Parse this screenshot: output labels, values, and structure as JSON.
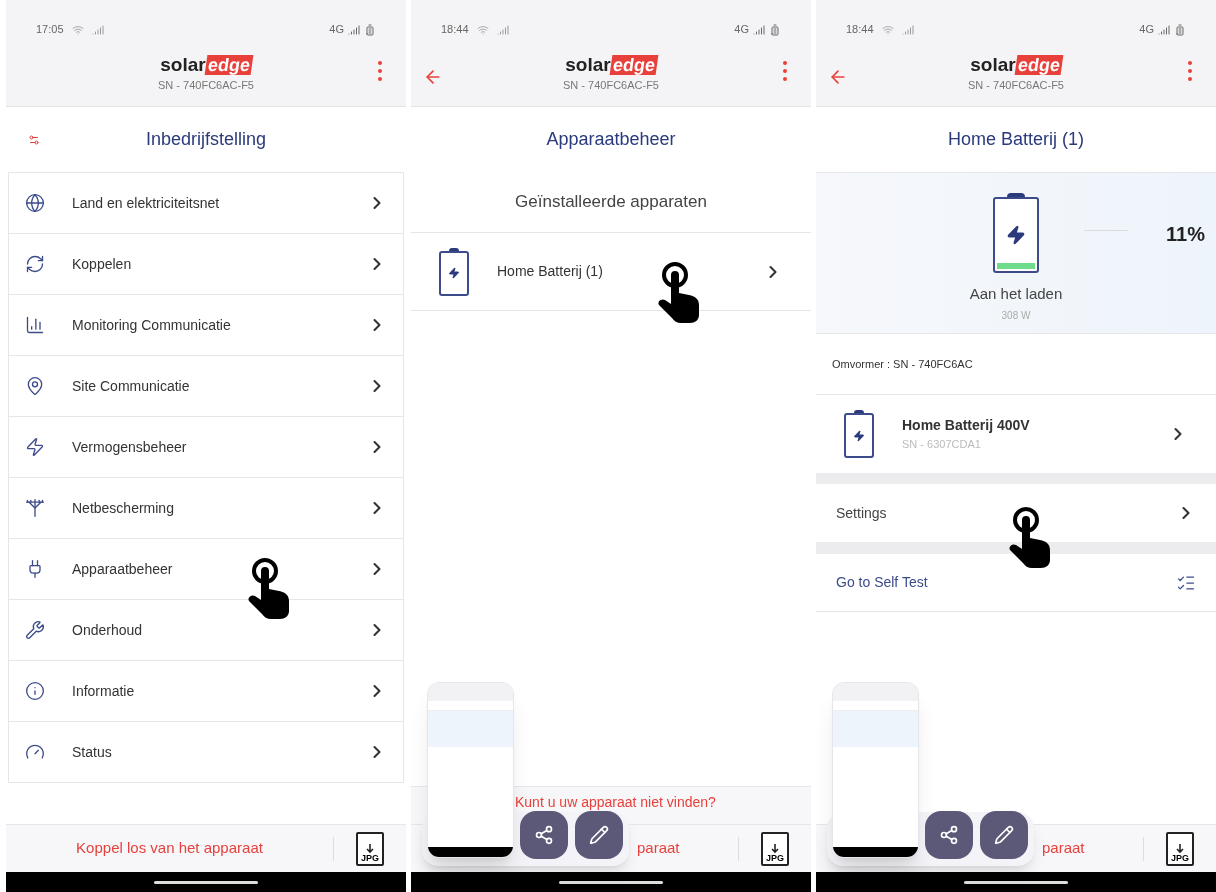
{
  "screens": [
    {
      "kind": "menu",
      "status_bar": {
        "time": "17:05",
        "network": "4G"
      },
      "header": {
        "back": false,
        "logo": [
          "solar",
          "edge"
        ],
        "serial": "SN - 740FC6AC-F5"
      },
      "title": "Inbedrijfstelling",
      "items": [
        {
          "label": "Land en elektriciteitsnet",
          "tapped": false
        },
        {
          "label": "Koppelen",
          "tapped": false
        },
        {
          "label": "Monitoring Communicatie",
          "tapped": false
        },
        {
          "label": "Site Communicatie",
          "tapped": false
        },
        {
          "label": "Vermogensbeheer",
          "tapped": false
        },
        {
          "label": "Netbescherming",
          "tapped": false
        },
        {
          "label": "Apparaatbeheer",
          "tapped": true
        },
        {
          "label": "Onderhoud",
          "tapped": false
        },
        {
          "label": "Informatie",
          "tapped": false
        },
        {
          "label": "Status",
          "tapped": false
        }
      ],
      "bottom_button": "Koppel los van het apparaat",
      "export_label": "JPG",
      "screenshot_toolbar": false
    },
    {
      "kind": "device_list",
      "status_bar": {
        "time": "18:44",
        "network": "4G"
      },
      "header": {
        "back": true,
        "logo": [
          "solar",
          "edge"
        ],
        "serial": "SN - 740FC6AC-F5"
      },
      "title": "Apparaatbeheer",
      "subtitle": "Geïnstalleerde apparaten",
      "devices": [
        {
          "name": "Home Batterij (1)",
          "tapped": true
        }
      ],
      "footer_link": "Kunt u uw apparaat niet vinden?",
      "bottom_button": "paraat",
      "export_label": "JPG",
      "screenshot_toolbar": true
    },
    {
      "kind": "battery_detail",
      "status_bar": {
        "time": "18:44",
        "network": "4G"
      },
      "header": {
        "back": true,
        "logo": [
          "solar",
          "edge"
        ],
        "serial": "SN - 740FC6AC-F5"
      },
      "title": "Home Batterij (1)",
      "battery": {
        "level": 0.11,
        "percent": "11%",
        "status": "Aan het laden",
        "power": "308 W"
      },
      "inverter": "Omvormer : SN - 740FC6AC",
      "device": {
        "name": "Home Batterij 400V",
        "serial": "SN - 6307CDA1"
      },
      "settings": {
        "label": "Settings",
        "tapped": true
      },
      "self_test": "Go to Self Test",
      "bottom_button": "paraat",
      "export_label": "JPG",
      "screenshot_toolbar": true
    }
  ]
}
